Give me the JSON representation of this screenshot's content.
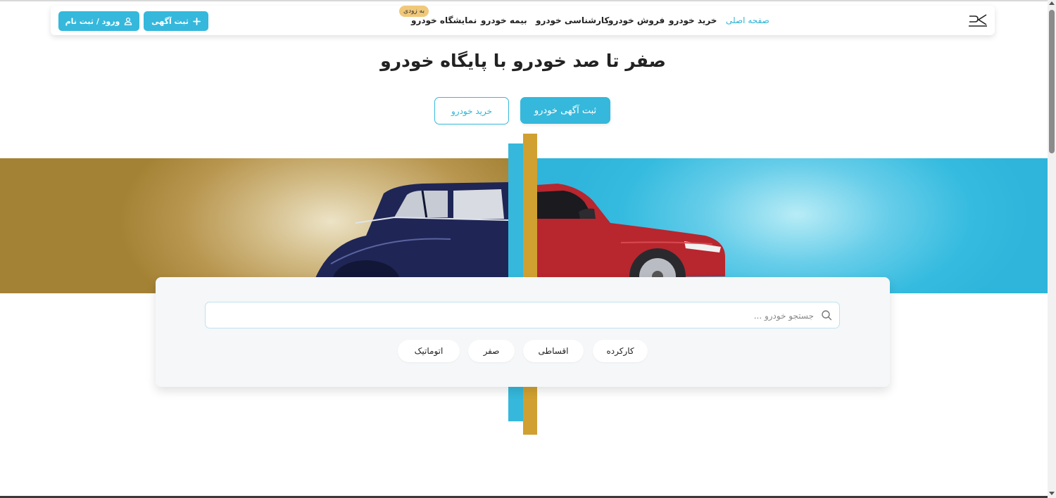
{
  "header": {
    "logo_icon": "pk-logo-icon",
    "nav": [
      {
        "label": "صفحه اصلی",
        "active": true
      },
      {
        "label": "خرید خودرو"
      },
      {
        "label": "فروش خودرو"
      },
      {
        "label": "کارشناسی خودرو"
      },
      {
        "label": "بیمه خودرو"
      },
      {
        "label": "نمایشگاه خودرو",
        "badge": "به زودی"
      }
    ],
    "post_ad_button": "ثبت آگهی",
    "post_ad_icon": "plus-icon",
    "login_button": "ورود / ثبت نام",
    "login_icon": "user-icon"
  },
  "hero": {
    "title": "صفر تا صد خودرو با پایگاه خودرو",
    "primary_button": "ثبت آگهی خودرو",
    "secondary_button": "خرید خودرو"
  },
  "search": {
    "placeholder": "جستجو خودرو ...",
    "icon": "search-icon",
    "chips": [
      "کارکرده",
      "اقساطی",
      "صفر",
      "اتوماتیک"
    ]
  },
  "colors": {
    "accent": "#35b8dc",
    "gold": "#d0a031",
    "badge": "#f0c87a"
  }
}
